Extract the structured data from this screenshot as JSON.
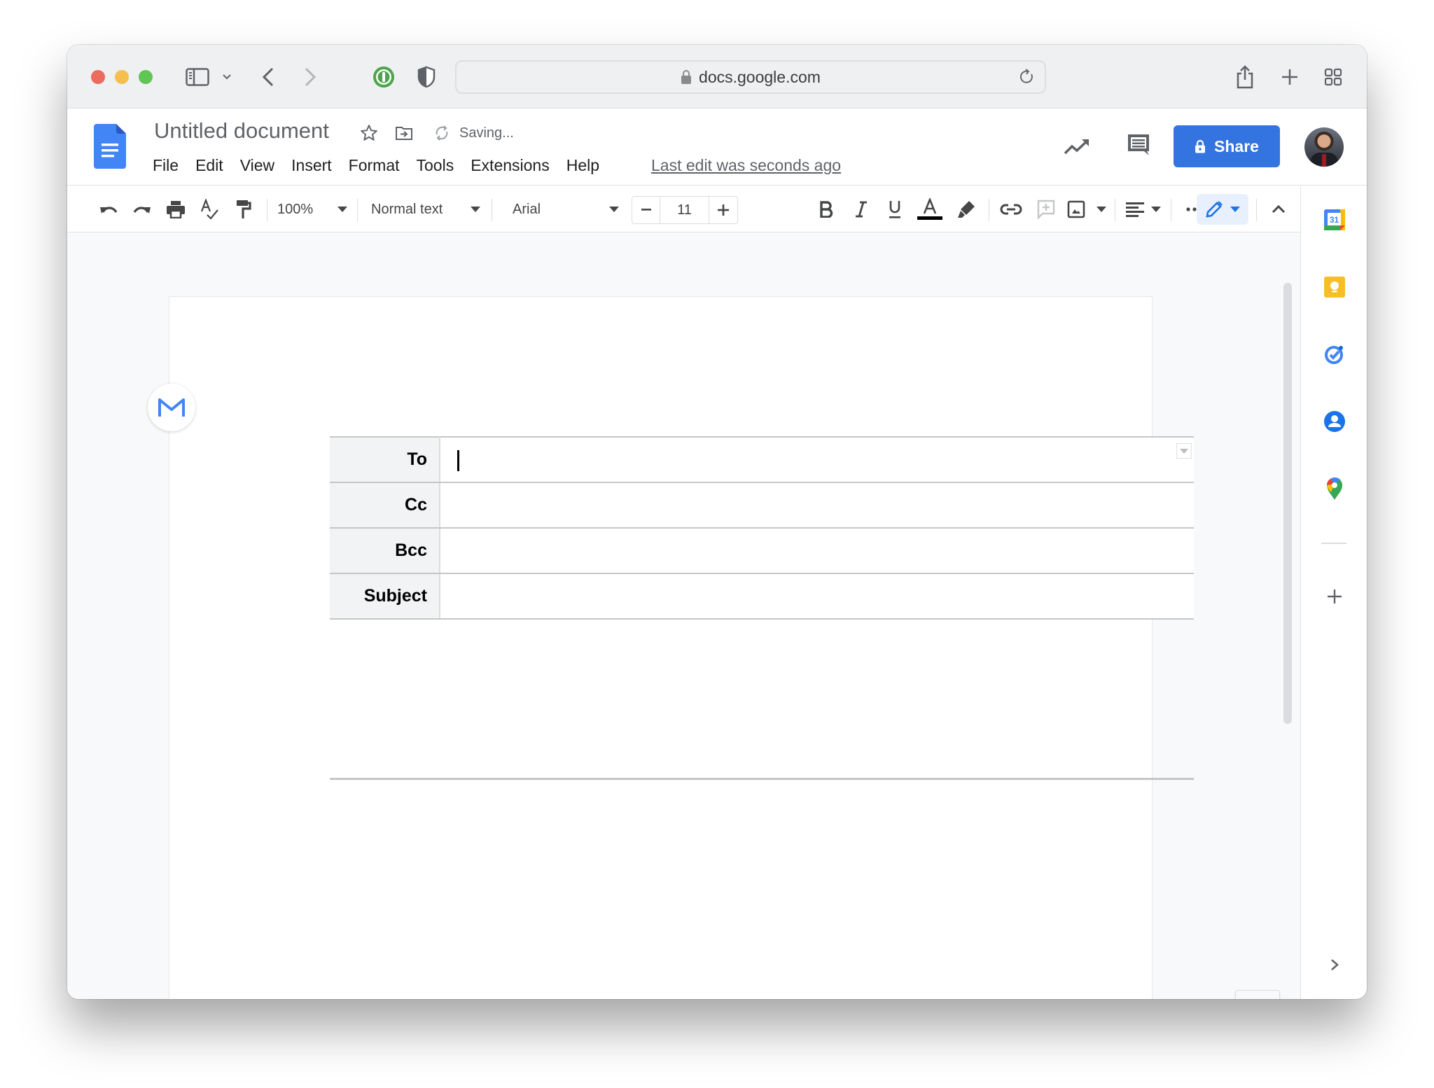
{
  "browser": {
    "url": "docs.google.com",
    "icons": [
      "sidebar-toggle-icon",
      "chevron-down-icon",
      "back-icon",
      "forward-icon",
      "password-manager-icon",
      "privacy-shield-icon",
      "lock-icon",
      "reload-icon",
      "share-icon",
      "new-tab-icon",
      "tab-overview-icon"
    ]
  },
  "doc": {
    "title": "Untitled document",
    "status": "Saving...",
    "last_edit": "Last edit was seconds ago",
    "menu": [
      "File",
      "Edit",
      "View",
      "Insert",
      "Format",
      "Tools",
      "Extensions",
      "Help"
    ],
    "share_label": "Share"
  },
  "toolbar": {
    "zoom": "100%",
    "style": "Normal text",
    "font": "Arial",
    "font_size": "11",
    "text_color": "#000000",
    "mode_color": "#1a73e8"
  },
  "email_draft": {
    "fields": [
      {
        "label": "To",
        "value": ""
      },
      {
        "label": "Cc",
        "value": ""
      },
      {
        "label": "Bcc",
        "value": ""
      },
      {
        "label": "Subject",
        "value": ""
      }
    ]
  },
  "side_panel": {
    "apps": [
      "Calendar",
      "Keep",
      "Tasks",
      "Contacts",
      "Maps"
    ],
    "calendar_day": "31"
  },
  "colors": {
    "accent": "#3474e0",
    "docs_blue": "#4285f4"
  }
}
